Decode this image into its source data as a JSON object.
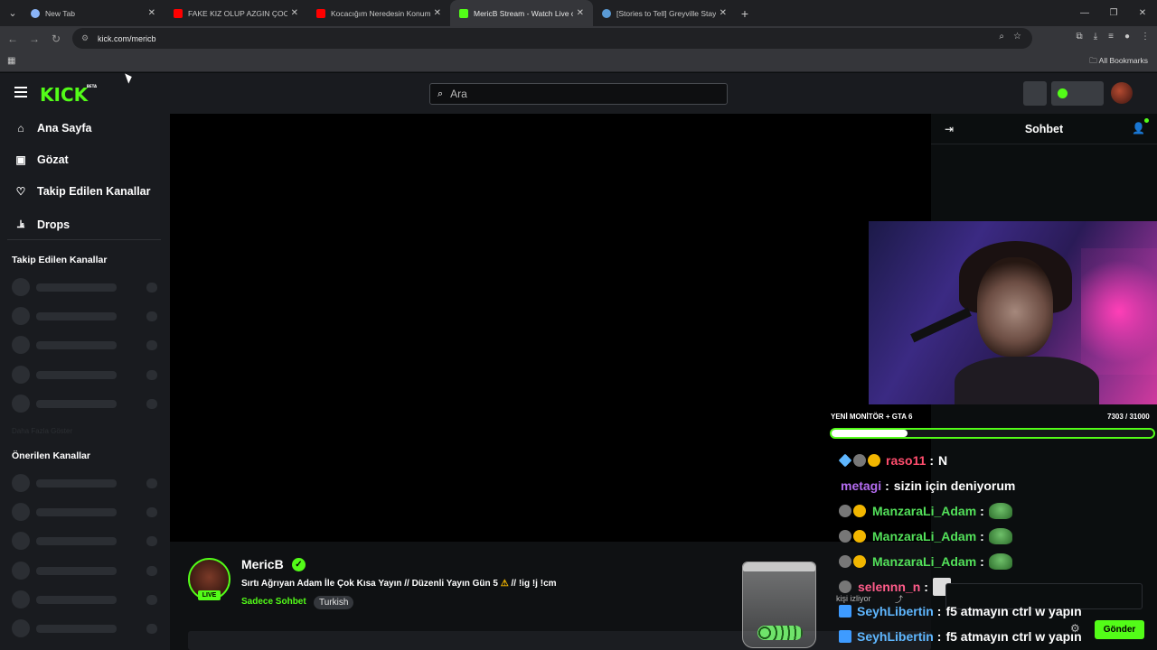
{
  "browser": {
    "tabs": [
      {
        "title": "New Tab",
        "favicon_color": "#8ab4f8"
      },
      {
        "title": "FAKE KIZ OLUP AZGIN ÇOCUĞU",
        "favicon_color": "#ff0000"
      },
      {
        "title": "Kocacığım Neredesin Konum A",
        "favicon_color": "#ff0000"
      },
      {
        "title": "MericB Stream - Watch Live on",
        "favicon_color": "#53fc18"
      },
      {
        "title": "[Stories to Tell] Greyville Stay on",
        "favicon_color": "#5b9bd5"
      }
    ],
    "url": "kick.com/mericb",
    "bookmarks_label": "All Bookmarks"
  },
  "kick": {
    "logo": "KICK",
    "logo_beta": "BETA",
    "search_placeholder": "Ara",
    "nav": [
      {
        "label": "Ana Sayfa",
        "icon": "home-icon"
      },
      {
        "label": "Gözat",
        "icon": "browse-icon"
      },
      {
        "label": "Takip Edilen Kanallar",
        "icon": "heart-icon"
      },
      {
        "label": "Drops",
        "icon": "drops-icon"
      }
    ],
    "followed_heading": "Takip Edilen Kanallar",
    "faded_text": "Daha Fazla Göster",
    "recommended_heading": "Önerilen Kanallar"
  },
  "stream": {
    "streamer": "MericB",
    "live_label": "LIVE",
    "title": "Sırtı Ağrıyan Adam İle Çok Kısa Yayın // Düzenli Yayın Gün 5",
    "title_suffix": "// !ig !j !cm",
    "category": "Sadece Sohbet",
    "language": "Turkish"
  },
  "chat": {
    "title": "Sohbet",
    "goal_label": "YENİ MONİTÖR + GTA 6",
    "goal_count": "7303 / 31000",
    "goal_progress": 0.2356,
    "viewers_text": "kişi izliyor",
    "send_label": "Gönder",
    "messages": [
      {
        "user": "raso11",
        "color": "#ff4d6d",
        "text": "N",
        "badges": [
          "gem",
          "gear",
          "coin"
        ]
      },
      {
        "user": "metagi",
        "color": "#b46cf0",
        "text": "sizin için deniyorum",
        "badges": []
      },
      {
        "user": "ManzaraLi_Adam",
        "color": "#53e05a",
        "text": "",
        "badges": [
          "gear",
          "coin"
        ],
        "emote": true
      },
      {
        "user": "ManzaraLi_Adam",
        "color": "#53e05a",
        "text": "",
        "badges": [
          "gear",
          "coin"
        ],
        "emote": true
      },
      {
        "user": "ManzaraLi_Adam",
        "color": "#53e05a",
        "text": "",
        "badges": [
          "gear",
          "coin"
        ],
        "emote": true
      },
      {
        "user": "selennn_n",
        "color": "#ff5c8a",
        "text": "",
        "badges": [
          "gear"
        ],
        "pic": true
      },
      {
        "user": "SeyhLibertin",
        "color": "#5fb7ff",
        "text": "f5 atmayın ctrl w yapın",
        "badges": [
          "kick"
        ]
      },
      {
        "user": "SeyhLibertin",
        "color": "#5fb7ff",
        "text": "f5 atmayın ctrl w yapın",
        "badges": [
          "kick"
        ]
      }
    ]
  }
}
